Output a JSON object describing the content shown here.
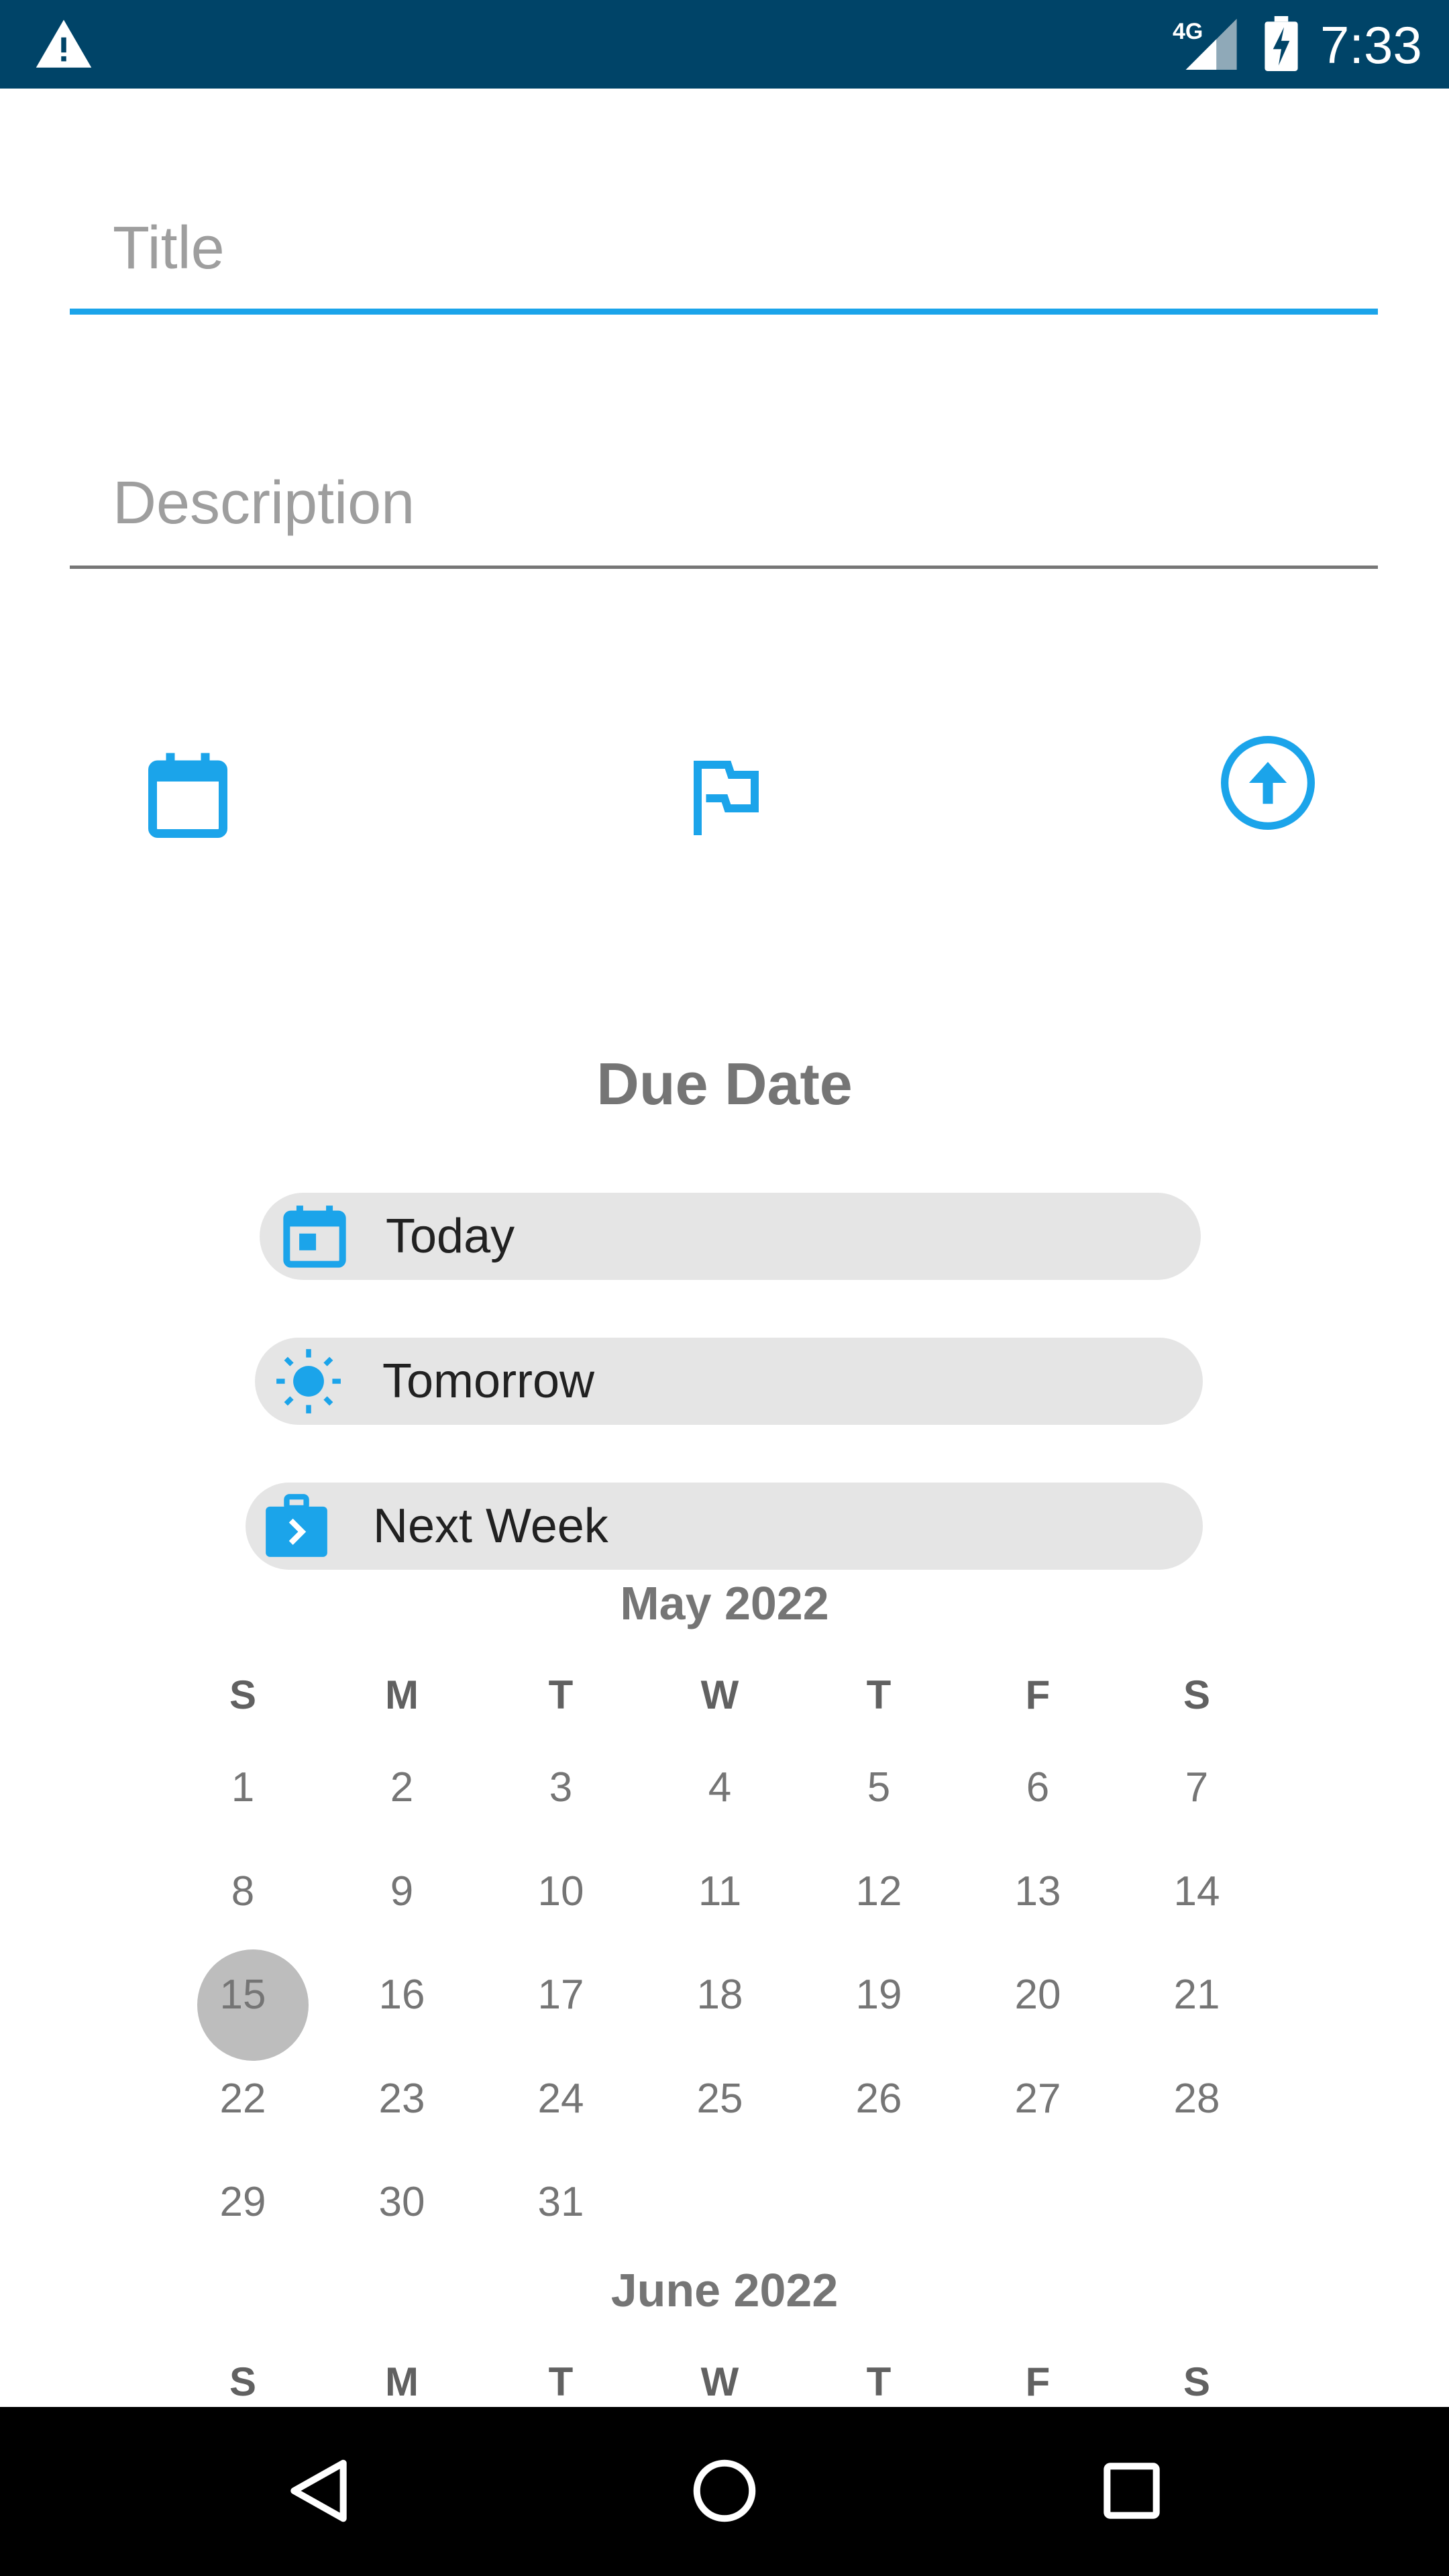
{
  "status_bar": {
    "network": "4G",
    "time": "7:33",
    "icons": [
      "warning-icon",
      "signal-icon",
      "battery-charging-icon"
    ]
  },
  "form": {
    "title_placeholder": "Title",
    "description_placeholder": "Description",
    "accent_color": "#1ba4ea"
  },
  "toolbar": {
    "icons": [
      "calendar-icon",
      "flag-icon",
      "arrow-up-circle-icon"
    ]
  },
  "due_date": {
    "heading": "Due Date",
    "options": [
      {
        "label": "Today",
        "icon": "calendar-today-icon"
      },
      {
        "label": "Tomorrow",
        "icon": "sun-icon"
      },
      {
        "label": "Next Week",
        "icon": "briefcase-next-icon"
      }
    ]
  },
  "calendar": {
    "weekday_headers": [
      "S",
      "M",
      "T",
      "W",
      "T",
      "F",
      "S"
    ],
    "months": [
      {
        "title": "May 2022",
        "weeks": [
          [
            "1",
            "2",
            "3",
            "4",
            "5",
            "6",
            "7"
          ],
          [
            "8",
            "9",
            "10",
            "11",
            "12",
            "13",
            "14"
          ],
          [
            "15",
            "16",
            "17",
            "18",
            "19",
            "20",
            "21"
          ],
          [
            "22",
            "23",
            "24",
            "25",
            "26",
            "27",
            "28"
          ],
          [
            "29",
            "30",
            "31",
            "",
            "",
            "",
            ""
          ]
        ],
        "selected": "15"
      },
      {
        "title": "June 2022",
        "weeks": []
      }
    ]
  },
  "nav_bar": {
    "icons": [
      "back-icon",
      "home-icon",
      "recents-icon"
    ]
  }
}
